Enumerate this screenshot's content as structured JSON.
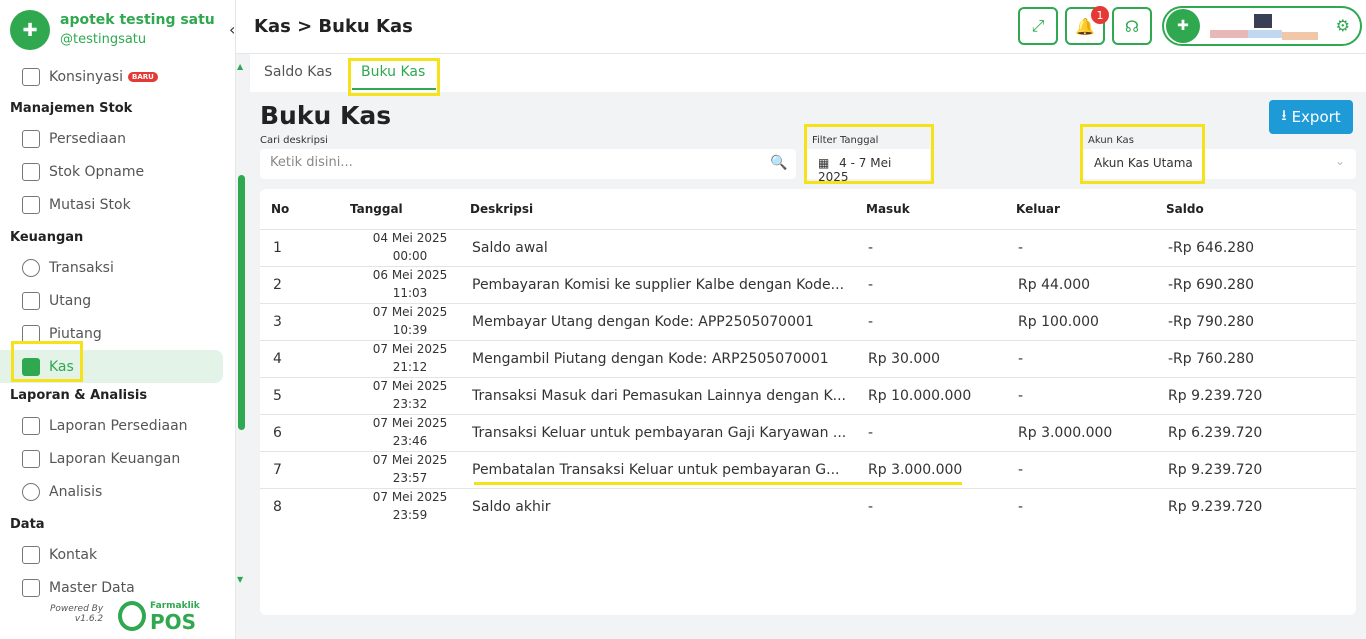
{
  "brand": {
    "name": "apotek testing satu",
    "handle": "@testingsatu"
  },
  "header": {
    "title": "Kas > Buku Kas",
    "notification_count": "1"
  },
  "sidebar": {
    "konsinyasi": {
      "label": "Konsinyasi",
      "badge": "BARU"
    },
    "sections": [
      {
        "title": "Manajemen Stok",
        "items": [
          "Persediaan",
          "Stok Opname",
          "Mutasi Stok"
        ]
      },
      {
        "title": "Keuangan",
        "items": [
          "Transaksi",
          "Utang",
          "Piutang",
          "Kas"
        ]
      },
      {
        "title": "Laporan & Analisis",
        "items": [
          "Laporan Persediaan",
          "Laporan Keuangan",
          "Analisis"
        ]
      },
      {
        "title": "Data",
        "items": [
          "Kontak",
          "Master Data"
        ]
      }
    ],
    "active": "Kas",
    "powered_by": "Powered By",
    "version": "v1.6.2",
    "footer_brand_small": "Farmaklik",
    "footer_brand_big": "POS"
  },
  "tabs": [
    {
      "label": "Saldo Kas"
    },
    {
      "label": "Buku Kas",
      "active": true
    }
  ],
  "main": {
    "heading": "Buku Kas",
    "export_label": "Export",
    "search": {
      "label": "Cari deskripsi",
      "placeholder": "Ketik disini..."
    },
    "filter": {
      "label": "Filter Tanggal",
      "value": "4 - 7 Mei 2025"
    },
    "akun": {
      "label": "Akun Kas",
      "value": "Akun Kas Utama"
    }
  },
  "table": {
    "columns": [
      "No",
      "Tanggal",
      "Deskripsi",
      "Masuk",
      "Keluar",
      "Saldo"
    ],
    "rows": [
      {
        "no": "1",
        "date": "04 Mei 2025",
        "time": "00:00",
        "desc": "Saldo awal",
        "masuk": "-",
        "keluar": "-",
        "saldo": "-Rp 646.280"
      },
      {
        "no": "2",
        "date": "06 Mei 2025",
        "time": "11:03",
        "desc": "Pembayaran Komisi ke supplier Kalbe dengan Kode...",
        "masuk": "-",
        "keluar": "Rp 44.000",
        "saldo": "-Rp 690.280"
      },
      {
        "no": "3",
        "date": "07 Mei 2025",
        "time": "10:39",
        "desc": "Membayar Utang dengan Kode: APP2505070001",
        "masuk": "-",
        "keluar": "Rp 100.000",
        "saldo": "-Rp 790.280"
      },
      {
        "no": "4",
        "date": "07 Mei 2025",
        "time": "21:12",
        "desc": "Mengambil Piutang dengan Kode: ARP2505070001",
        "masuk": "Rp 30.000",
        "keluar": "-",
        "saldo": "-Rp 760.280"
      },
      {
        "no": "5",
        "date": "07 Mei 2025",
        "time": "23:32",
        "desc": "Transaksi Masuk dari Pemasukan Lainnya dengan K...",
        "masuk": "Rp 10.000.000",
        "keluar": "-",
        "saldo": "Rp 9.239.720"
      },
      {
        "no": "6",
        "date": "07 Mei 2025",
        "time": "23:46",
        "desc": "Transaksi Keluar untuk pembayaran Gaji Karyawan ...",
        "masuk": "-",
        "keluar": "Rp 3.000.000",
        "saldo": "Rp 6.239.720"
      },
      {
        "no": "7",
        "date": "07 Mei 2025",
        "time": "23:57",
        "desc": "Pembatalan Transaksi Keluar untuk pembayaran G...",
        "masuk": "Rp 3.000.000",
        "keluar": "-",
        "saldo": "Rp 9.239.720"
      },
      {
        "no": "8",
        "date": "07 Mei 2025",
        "time": "23:59",
        "desc": "Saldo akhir",
        "masuk": "-",
        "keluar": "-",
        "saldo": "Rp 9.239.720"
      }
    ]
  },
  "colors": {
    "accent": "#2fa84f",
    "export": "#1e9bd7",
    "highlight": "#f5e21a",
    "badge": "#e53935"
  }
}
